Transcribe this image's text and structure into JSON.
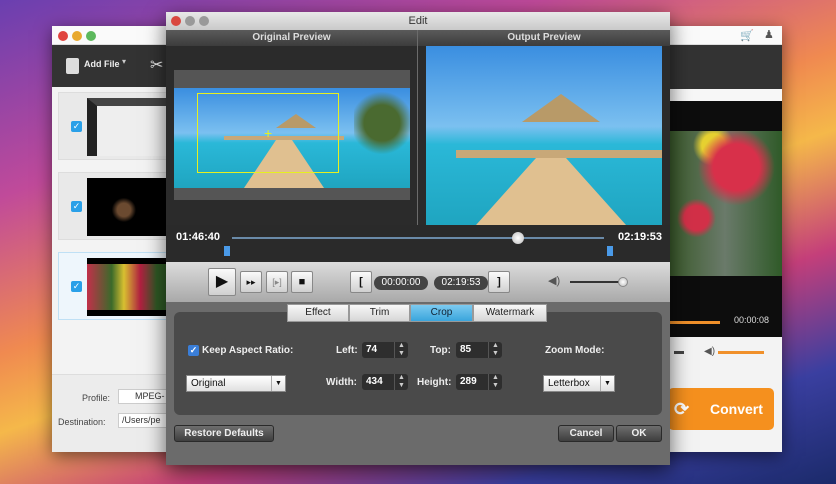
{
  "main_window": {
    "add_file": "Add File",
    "profile_label": "Profile:",
    "profile_value": "MPEG-",
    "destination_label": "Destination:",
    "destination_value": "/Users/pe",
    "preview_time": "00:00:08",
    "convert": "Convert"
  },
  "dialog": {
    "title": "Edit",
    "original_preview": "Original Preview",
    "output_preview": "Output Preview",
    "timeline": {
      "start": "01:46:40",
      "end": "02:19:53",
      "position": 0.77
    },
    "controls": {
      "trim_start": "00:00:00",
      "trim_end": "02:19:53",
      "volume": 0.95
    },
    "tabs": [
      {
        "label": "Effect"
      },
      {
        "label": "Trim"
      },
      {
        "label": "Crop",
        "active": true
      },
      {
        "label": "Watermark"
      }
    ],
    "crop": {
      "keep_aspect_label": "Keep Aspect Ratio:",
      "keep_aspect_checked": true,
      "aspect_value": "Original",
      "left_label": "Left:",
      "left": "74",
      "top_label": "Top:",
      "top": "85",
      "width_label": "Width:",
      "width": "434",
      "height_label": "Height:",
      "height": "289",
      "zoom_mode_label": "Zoom Mode:",
      "zoom_mode": "Letterbox"
    },
    "restore_defaults": "Restore Defaults",
    "cancel": "Cancel",
    "ok": "OK"
  },
  "colors": {
    "accent": "#2aa0e8",
    "convert": "#f5901e"
  }
}
